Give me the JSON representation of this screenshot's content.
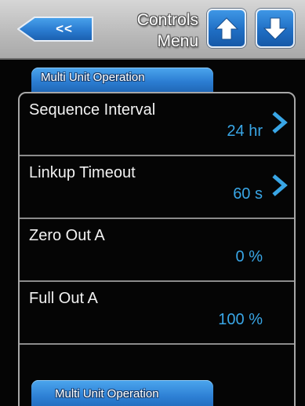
{
  "header": {
    "back_label": "<<",
    "title_line1": "Controls",
    "title_line2": "Menu",
    "up_icon": "arrow-up-icon",
    "down_icon": "arrow-down-icon"
  },
  "tabs": {
    "top_label": "Multi Unit Operation",
    "bottom_label": "Multi Unit Operation"
  },
  "rows": [
    {
      "label": "Sequence Interval",
      "value": "24 hr",
      "has_chevron": true
    },
    {
      "label": "Linkup Timeout",
      "value": "60 s",
      "has_chevron": true
    },
    {
      "label": "Zero Out A",
      "value": "0 %",
      "has_chevron": false
    },
    {
      "label": "Full Out A",
      "value": "100 %",
      "has_chevron": false
    }
  ],
  "colors": {
    "accent_blue": "#2c7ed3",
    "value_blue": "#39a6e6",
    "header_gray": "#bdbdbd",
    "background": "#050505"
  }
}
